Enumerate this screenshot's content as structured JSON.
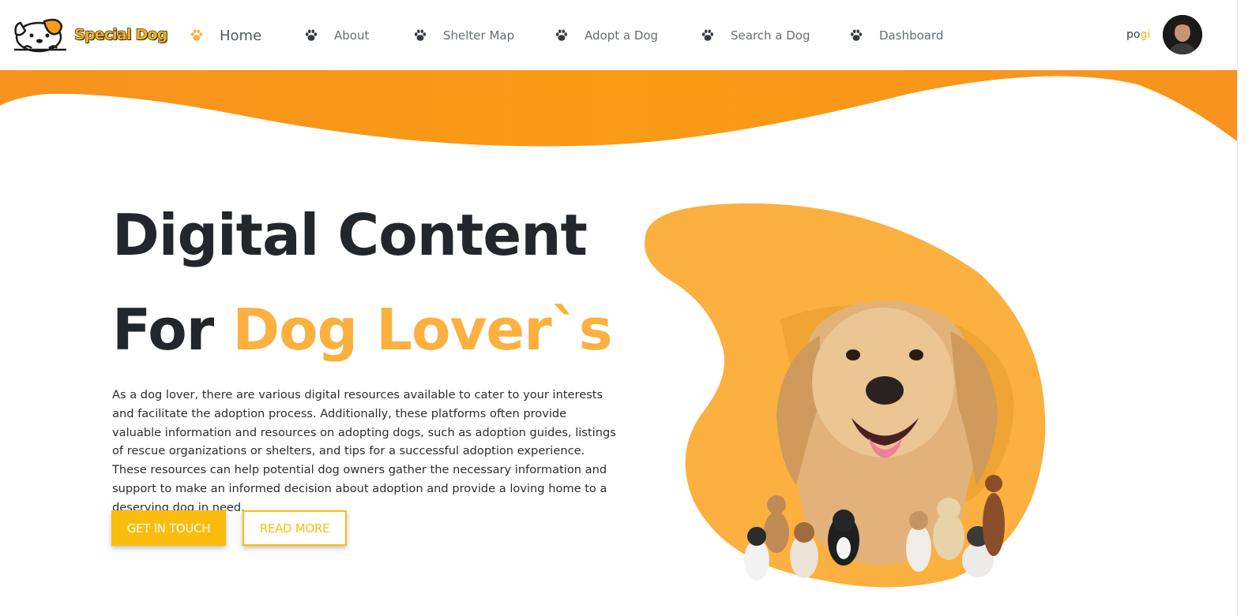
{
  "brand": {
    "name": "Special Dog",
    "icon": "dog-mascot-icon"
  },
  "nav": {
    "items": [
      {
        "label": "Home",
        "icon": "paw-icon",
        "active": true
      },
      {
        "label": "About",
        "icon": "paw-icon",
        "active": false
      },
      {
        "label": "Shelter Map",
        "icon": "paw-icon",
        "active": false
      },
      {
        "label": "Adopt a Dog",
        "icon": "paw-icon",
        "active": false
      },
      {
        "label": "Search a Dog",
        "icon": "paw-icon",
        "active": false
      },
      {
        "label": "Dashboard",
        "icon": "paw-icon",
        "active": false
      }
    ]
  },
  "user": {
    "name_part1": "po",
    "name_part2": "gi",
    "avatar": "user-avatar"
  },
  "hero": {
    "title_line1": "Digital Content",
    "title_line2_prefix": "For ",
    "title_line2_accent": "Dog Lover`s",
    "description": "As a dog lover, there are various digital resources available to cater to your interests and facilitate the adoption process. Additionally, these platforms often provide valuable information and resources on adopting dogs, such as adoption guides, listings of rescue organizations or shelters, and tips for a successful adoption experience. These resources can help potential dog owners gather the necessary information and support to make an informed decision about adoption and provide a loving home to a deserving dog in need.",
    "primary_button": "GET IN TOUCH",
    "secondary_button": "READ MORE",
    "image": "golden-retriever-with-dogs"
  },
  "colors": {
    "accent": "#fbb040",
    "orange": "#f89d17",
    "button_yellow": "#fbbd0d",
    "text_dark": "#23262b",
    "nav_text": "#666d74"
  }
}
